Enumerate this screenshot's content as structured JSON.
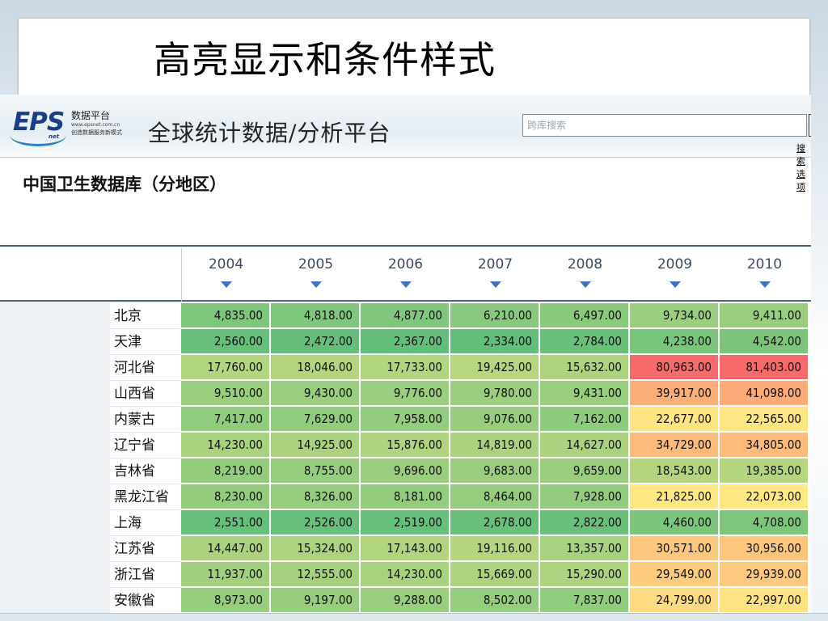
{
  "slide": {
    "title": "高亮显示和条件样式"
  },
  "banner": {
    "logo_text": "EPS",
    "logo_net": "net",
    "logo_cn": "数据平台",
    "logo_url": "www.epsnet.com.cn",
    "logo_slogan": "创造数据服务新模式",
    "platform_title": "全球统计数据/分析平台",
    "search_placeholder": "跨库搜索",
    "search_options": "搜索选项"
  },
  "database": {
    "title": "中国卫生数据库（分地区）"
  },
  "chart_data": {
    "type": "table",
    "title": "中国卫生数据库（分地区）",
    "columns": [
      "2004",
      "2005",
      "2006",
      "2007",
      "2008",
      "2009",
      "2010"
    ],
    "rows": [
      {
        "label": "北京",
        "values": [
          "4,835.00",
          "4,818.00",
          "4,877.00",
          "6,210.00",
          "6,497.00",
          "9,734.00",
          "9,411.00"
        ]
      },
      {
        "label": "天津",
        "values": [
          "2,560.00",
          "2,472.00",
          "2,367.00",
          "2,334.00",
          "2,784.00",
          "4,238.00",
          "4,542.00"
        ]
      },
      {
        "label": "河北省",
        "values": [
          "17,760.00",
          "18,046.00",
          "17,733.00",
          "19,425.00",
          "15,632.00",
          "80,963.00",
          "81,403.00"
        ]
      },
      {
        "label": "山西省",
        "values": [
          "9,510.00",
          "9,430.00",
          "9,776.00",
          "9,780.00",
          "9,431.00",
          "39,917.00",
          "41,098.00"
        ]
      },
      {
        "label": "内蒙古",
        "values": [
          "7,417.00",
          "7,629.00",
          "7,958.00",
          "9,076.00",
          "7,162.00",
          "22,677.00",
          "22,565.00"
        ]
      },
      {
        "label": "辽宁省",
        "values": [
          "14,230.00",
          "14,925.00",
          "15,876.00",
          "14,819.00",
          "14,627.00",
          "34,729.00",
          "34,805.00"
        ]
      },
      {
        "label": "吉林省",
        "values": [
          "8,219.00",
          "8,755.00",
          "9,696.00",
          "9,683.00",
          "9,659.00",
          "18,543.00",
          "19,385.00"
        ]
      },
      {
        "label": "黑龙江省",
        "values": [
          "8,230.00",
          "8,326.00",
          "8,181.00",
          "8,464.00",
          "7,928.00",
          "21,825.00",
          "22,073.00"
        ]
      },
      {
        "label": "上海",
        "values": [
          "2,551.00",
          "2,526.00",
          "2,519.00",
          "2,678.00",
          "2,822.00",
          "4,460.00",
          "4,708.00"
        ]
      },
      {
        "label": "江苏省",
        "values": [
          "14,447.00",
          "15,324.00",
          "17,143.00",
          "19,116.00",
          "13,357.00",
          "30,571.00",
          "30,956.00"
        ]
      },
      {
        "label": "浙江省",
        "values": [
          "11,937.00",
          "12,555.00",
          "14,230.00",
          "15,669.00",
          "15,290.00",
          "29,549.00",
          "29,939.00"
        ]
      },
      {
        "label": "安徽省",
        "values": [
          "8,973.00",
          "9,197.00",
          "9,288.00",
          "8,502.00",
          "7,837.00",
          "24,799.00",
          "22,997.00"
        ]
      }
    ],
    "color_scale": {
      "low": "#63be7b",
      "mid": "#ffeb84",
      "high": "#f8696b"
    }
  }
}
